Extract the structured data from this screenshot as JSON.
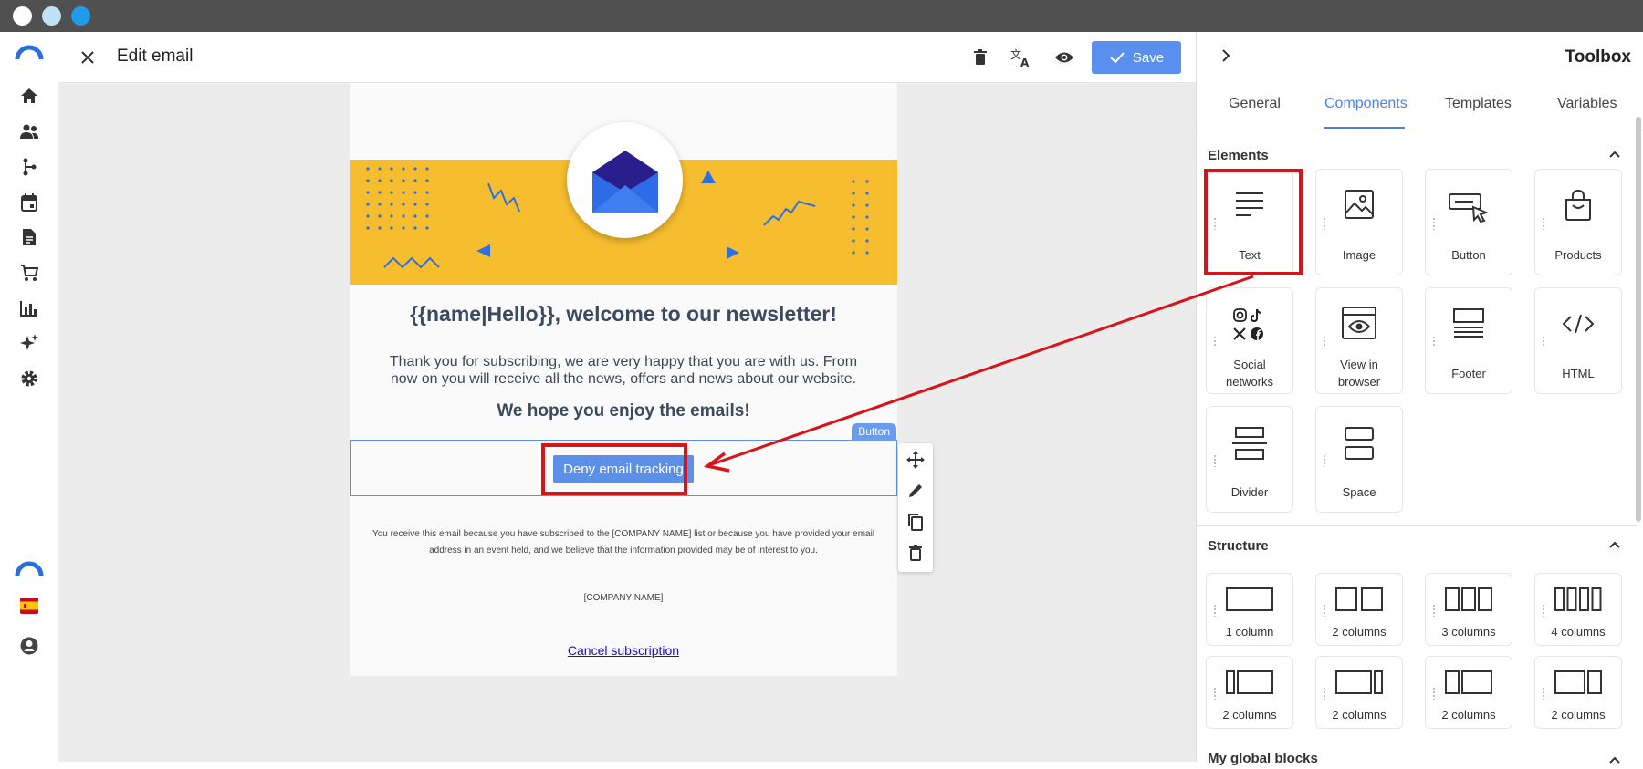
{
  "header": {
    "title": "Edit email",
    "save_label": "Save"
  },
  "email": {
    "heading": "{{name|Hello}}, welcome to our newsletter!",
    "paragraph": "Thank you for subscribing, we are very happy that you are with us. From now on you will receive all the news, offers and news about our website.",
    "subheading": "We hope you enjoy the emails!",
    "selected_block_tag": "Button",
    "button_label": "Deny email tracking",
    "footer_text": "You receive this email because you have subscribed to the [COMPANY NAME] list or because you have provided your email address in an event held, and we believe that the information provided may be of interest to you.",
    "company": "[COMPANY NAME]",
    "cancel_link": "Cancel subscription"
  },
  "toolbox": {
    "title": "Toolbox",
    "tabs": [
      "General",
      "Components",
      "Templates",
      "Variables"
    ],
    "active_tab": "Components",
    "elements_title": "Elements",
    "elements": [
      {
        "label": "Text",
        "icon": "text-lines-icon"
      },
      {
        "label": "Image",
        "icon": "image-icon"
      },
      {
        "label": "Button",
        "icon": "button-cursor-icon"
      },
      {
        "label": "Products",
        "icon": "shopping-bag-icon"
      },
      {
        "label": "Social networks",
        "icon": "social-icons"
      },
      {
        "label": "View in browser",
        "icon": "browser-eye-icon"
      },
      {
        "label": "Footer",
        "icon": "footer-icon"
      },
      {
        "label": "HTML",
        "icon": "code-icon"
      },
      {
        "label": "Divider",
        "icon": "divider-icon"
      },
      {
        "label": "Space",
        "icon": "space-icon"
      }
    ],
    "structure_title": "Structure",
    "structures": [
      {
        "label": "1 column"
      },
      {
        "label": "2 columns"
      },
      {
        "label": "3 columns"
      },
      {
        "label": "4 columns"
      },
      {
        "label": "2 columns"
      },
      {
        "label": "2 columns"
      },
      {
        "label": "2 columns"
      },
      {
        "label": "2 columns"
      }
    ],
    "global_blocks_title": "My global blocks"
  },
  "colors": {
    "accent": "#4a82e8",
    "save_button": "#5a8ff0",
    "banner": "#f6bd2e",
    "annotation": "#d8131a",
    "titlebar": "#505050"
  },
  "nav_icons": [
    "home-icon",
    "contacts-icon",
    "automation-icon",
    "calendar-icon",
    "document-icon",
    "cart-icon",
    "stats-icon",
    "sparkle-icon",
    "settings-icon"
  ]
}
